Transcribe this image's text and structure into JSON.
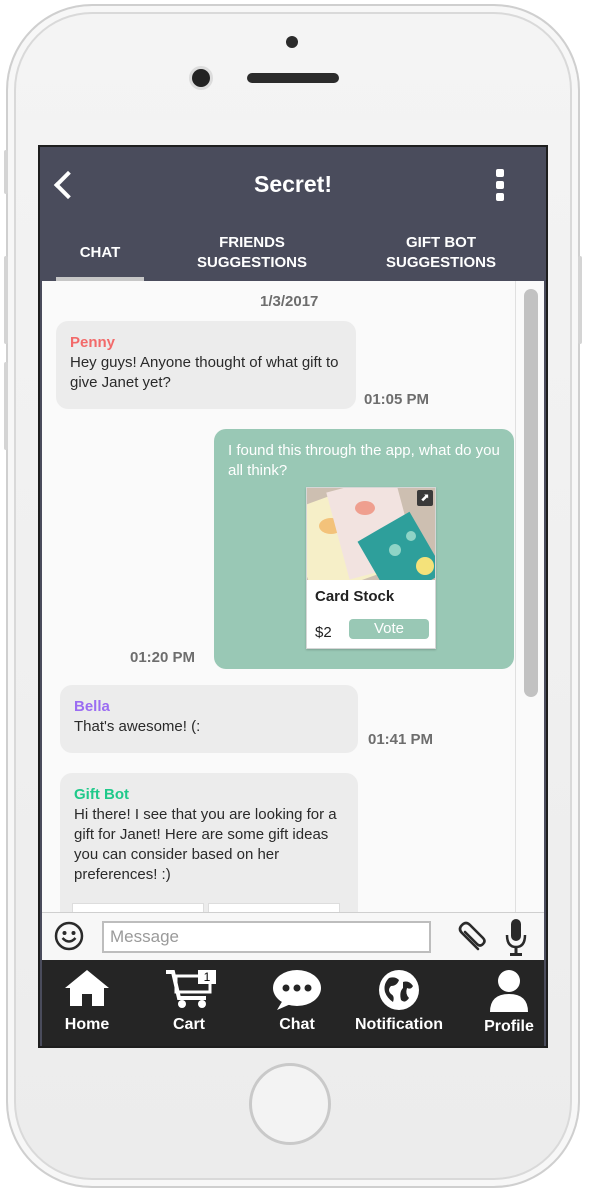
{
  "header": {
    "title": "Secret!"
  },
  "tabs": [
    {
      "label_line1": "CHAT",
      "label_line2": ""
    },
    {
      "label_line1": "FRIENDS",
      "label_line2": "SUGGESTIONS"
    },
    {
      "label_line1": "GIFT BOT",
      "label_line2": "SUGGESTIONS"
    }
  ],
  "chat": {
    "date": "1/3/2017",
    "messages": [
      {
        "sender": "Penny",
        "sender_color": "#f26a6a",
        "text": "Hey guys! Anyone thought of what gift to give Janet yet?",
        "time": "01:05 PM"
      },
      {
        "sender": "",
        "text": "I found this through the app, what do you all think?",
        "time": "01:20 PM",
        "product": {
          "name": "Card Stock",
          "price": "$2",
          "vote_label": "Vote"
        }
      },
      {
        "sender": "Bella",
        "sender_color": "#9b6cf2",
        "text": "That's awesome! (:",
        "time": "01:41 PM"
      },
      {
        "sender": "Gift Bot",
        "sender_color": "#1fc98a",
        "text": "Hi there! I see that you are looking for a gift for Janet! Here are some gift ideas you can consider based on her preferences! :)",
        "time": ""
      }
    ]
  },
  "input": {
    "placeholder": "Message"
  },
  "nav": [
    {
      "label": "Home",
      "icon": "home-icon"
    },
    {
      "label": "Cart",
      "icon": "cart-icon",
      "badge": "1"
    },
    {
      "label": "Chat",
      "icon": "chat-bubble-icon"
    },
    {
      "label": "Notification",
      "icon": "globe-icon"
    },
    {
      "label": "Profile",
      "icon": "profile-icon"
    }
  ],
  "colors": {
    "header": "#4a4c5c",
    "outgoing_bubble": "#99c8b5",
    "bottom_nav": "#252525"
  }
}
